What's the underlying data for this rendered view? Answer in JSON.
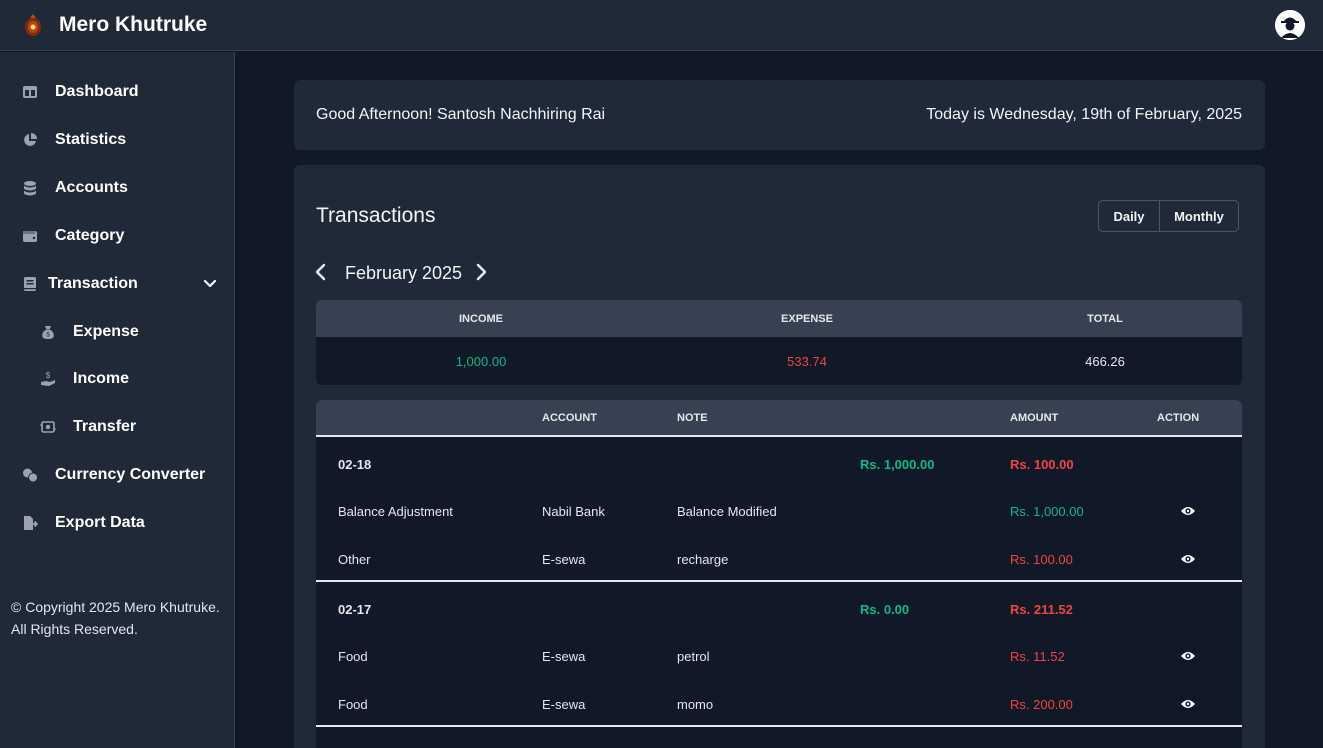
{
  "app": {
    "title": "Mero Khutruke"
  },
  "sidebar": {
    "items": [
      {
        "label": "Dashboard",
        "icon": "table-columns-icon"
      },
      {
        "label": "Statistics",
        "icon": "pie-chart-icon"
      },
      {
        "label": "Accounts",
        "icon": "database-icon"
      },
      {
        "label": "Category",
        "icon": "wallet-icon"
      },
      {
        "label": "Transaction",
        "icon": "book-icon"
      },
      {
        "label": "Expense",
        "icon": "money-bag-icon"
      },
      {
        "label": "Income",
        "icon": "hand-coin-icon"
      },
      {
        "label": "Transfer",
        "icon": "money-bill-transfer-icon"
      },
      {
        "label": "Currency Converter",
        "icon": "coins-exchange-icon"
      },
      {
        "label": "Export Data",
        "icon": "file-export-icon"
      }
    ],
    "copyright": "© Copyright 2025 Mero Khutruke. All Rights Reserved."
  },
  "header": {
    "greeting": "Good Afternoon! Santosh Nachhiring Rai",
    "today": "Today is Wednesday, 19th of February, 2025"
  },
  "transactions": {
    "title": "Transactions",
    "view_daily": "Daily",
    "view_monthly": "Monthly",
    "period": "February 2025",
    "summary": {
      "income_label": "INCOME",
      "expense_label": "EXPENSE",
      "total_label": "TOTAL",
      "income": "1,000.00",
      "expense": "533.74",
      "total": "466.26"
    },
    "columns": {
      "account": "ACCOUNT",
      "note": "NOTE",
      "amount": "AMOUNT",
      "action": "ACTION"
    },
    "groups": [
      {
        "date": "02-18",
        "income": "Rs. 1,000.00",
        "expense": "Rs. 100.00",
        "rows": [
          {
            "category": "Balance Adjustment",
            "account": "Nabil Bank",
            "note": "Balance Modified",
            "amount": "Rs. 1,000.00",
            "type": "income"
          },
          {
            "category": "Other",
            "account": "E-sewa",
            "note": "recharge",
            "amount": "Rs. 100.00",
            "type": "expense"
          }
        ]
      },
      {
        "date": "02-17",
        "income": "Rs. 0.00",
        "expense": "Rs. 211.52",
        "rows": [
          {
            "category": "Food",
            "account": "E-sewa",
            "note": "petrol",
            "amount": "Rs. 11.52",
            "type": "expense"
          },
          {
            "category": "Food",
            "account": "E-sewa",
            "note": "momo",
            "amount": "Rs. 200.00",
            "type": "expense"
          }
        ]
      }
    ]
  },
  "colors": {
    "income": "#10b981",
    "expense": "#ef4444",
    "panel": "#1f2937",
    "background": "#111827"
  }
}
